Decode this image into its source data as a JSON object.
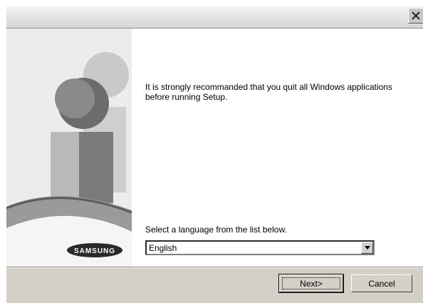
{
  "window": {
    "close_icon": "close-icon"
  },
  "message": "It is strongly recommanded that you quit all Windows applications before running Setup.",
  "language": {
    "label": "Select a language from the list below.",
    "selected": "English"
  },
  "buttons": {
    "next": "Next>",
    "cancel": "Cancel"
  },
  "logo_text": "SAMSUNG",
  "colors": {
    "dialog_bg": "#d4d0c8",
    "sidebar_bg": "#e9e9e9",
    "figure_dark": "#6a6a6a",
    "figure_light": "#b9b9b9"
  }
}
